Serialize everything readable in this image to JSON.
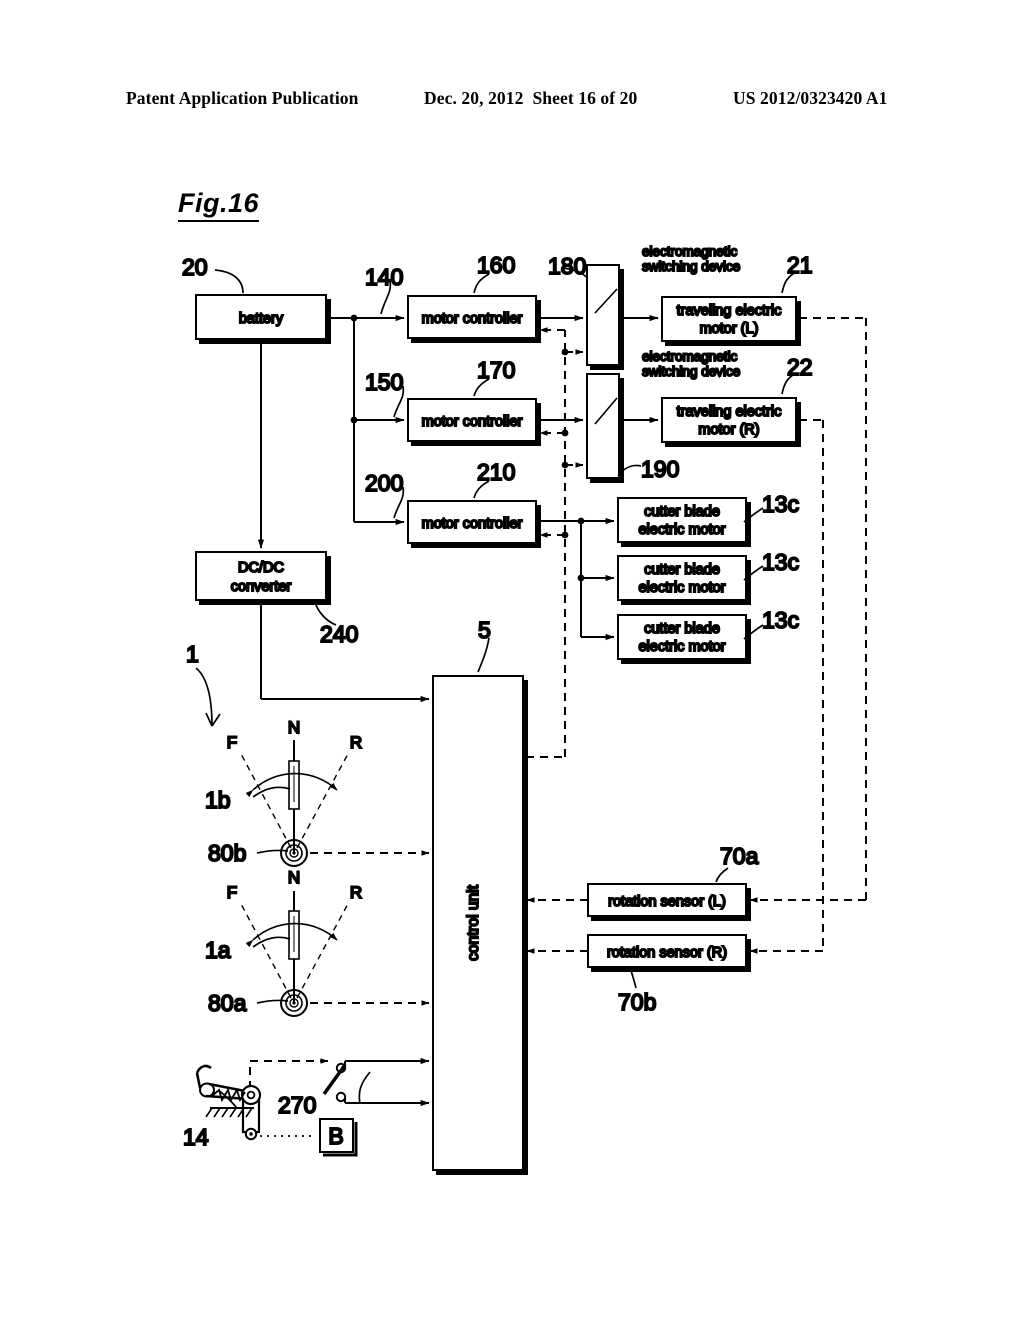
{
  "header": {
    "left": "Patent Application Publication",
    "date": "Dec. 20, 2012",
    "sheet": "Sheet 16 of 20",
    "patent_number": "US 2012/0323420 A1"
  },
  "figure": {
    "label": "Fig.16"
  },
  "blocks": {
    "battery": "battery",
    "motor_controller_1": "motor controller",
    "motor_controller_2": "motor controller",
    "motor_controller_3": "motor controller",
    "dcdc_converter_line1": "DC/DC",
    "dcdc_converter_line2": "converter",
    "traveling_motor_l_line1": "traveling electric",
    "traveling_motor_l_line2": "motor (L)",
    "traveling_motor_r_line1": "traveling electric",
    "traveling_motor_r_line2": "motor (R)",
    "cutter_blade_1_line1": "cutter blade",
    "cutter_blade_1_line2": "electric motor",
    "cutter_blade_2_line1": "cutter blade",
    "cutter_blade_2_line2": "electric motor",
    "cutter_blade_3_line1": "cutter blade",
    "cutter_blade_3_line2": "electric motor",
    "control_unit": "control unit",
    "rotation_sensor_l": "rotation sensor (L)",
    "rotation_sensor_r": "rotation sensor (R)",
    "brake_box": "B"
  },
  "annotations": {
    "electromagnetic_switching_device_1_line1": "electromagnetic",
    "electromagnetic_switching_device_1_line2": "switching device",
    "electromagnetic_switching_device_2_line1": "electromagnetic",
    "electromagnetic_switching_device_2_line2": "switching device"
  },
  "reference_numerals": {
    "machine": "1",
    "control_unit": "5",
    "battery": "20",
    "traveling_motor_l": "21",
    "traveling_motor_r": "22",
    "cutter_blade_1": "13c",
    "cutter_blade_2": "13c",
    "cutter_blade_3": "13c",
    "brake_pedal": "14",
    "rotation_sensor_l": "70a",
    "rotation_sensor_r": "70b",
    "lever_b": "1b",
    "lever_a": "1a",
    "lever_sensor_b": "80b",
    "lever_sensor_a": "80a",
    "power_line_140": "140",
    "power_line_150": "150",
    "motor_controller_160": "160",
    "motor_controller_170": "170",
    "switching_device_180": "180",
    "switching_device_190": "190",
    "power_line_200": "200",
    "motor_controller_210": "210",
    "dcdc_converter": "240",
    "brake_switch": "270"
  },
  "lever_marks": {
    "lever_b_forward": "F",
    "lever_b_neutral": "N",
    "lever_b_reverse": "R",
    "lever_a_forward": "F",
    "lever_a_neutral": "N",
    "lever_a_reverse": "R"
  },
  "colors": {
    "ink": "#000000",
    "background": "#ffffff"
  }
}
